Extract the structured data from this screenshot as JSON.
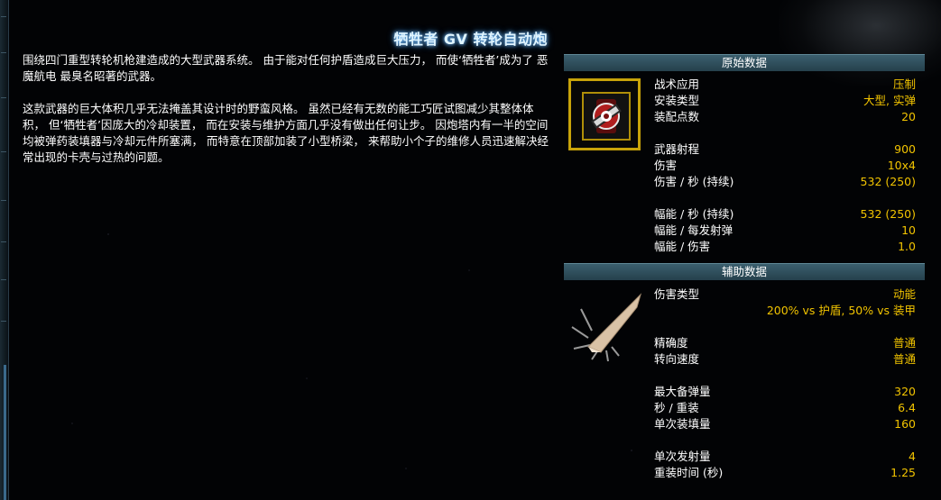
{
  "weapon": {
    "name": "牺牲者 GV 转轮自动炮",
    "description": [
      "围绕四门重型转轮机枪建造成的大型武器系统。 由于能对任何护盾造成巨大压力， 而使‘牺牲者’成为了 恶魔航电 最臭名昭著的武器。",
      "这款武器的巨大体积几乎无法掩盖其设计时的野蛮风格。 虽然已经有无数的能工巧匠试图减少其整体体积， 但‘牺牲者’因庞大的冷却装置， 而在安装与维护方面几乎没有做出任何让步。 因炮塔内有一半的空间均被弹药装填器与冷却元件所塞满， 而特意在顶部加装了小型桥梁， 来帮助小个子的维修人员迅速解决经常出现的卡壳与过热的问题。"
    ]
  },
  "primary": {
    "header": "原始数据",
    "icon": "turret-weapon-icon",
    "groups": [
      [
        {
          "label": "战术应用",
          "value": "压制"
        },
        {
          "label": "安装类型",
          "value": "大型, 实弹"
        },
        {
          "label": "装配点数",
          "value": "20"
        }
      ],
      [
        {
          "label": "武器射程",
          "value": "900"
        },
        {
          "label": "伤害",
          "value": "10x4"
        },
        {
          "label": "伤害 / 秒 (持续)",
          "value": "532 (250)"
        }
      ],
      [
        {
          "label": "幅能 / 秒 (持续)",
          "value": "532 (250)"
        },
        {
          "label": "幅能 / 每发射弹",
          "value": "10"
        },
        {
          "label": "幅能 / 伤害",
          "value": "1.0"
        }
      ]
    ]
  },
  "secondary": {
    "header": "辅助数据",
    "icon": "kinetic-damage-icon",
    "damage_type_label": "伤害类型",
    "damage_type_value": "动能",
    "damage_modifier": "200% vs 护盾, 50% vs 装甲",
    "groups": [
      [
        {
          "label": "精确度",
          "value": "普通"
        },
        {
          "label": "转向速度",
          "value": "普通"
        }
      ],
      [
        {
          "label": "最大备弹量",
          "value": "320"
        },
        {
          "label": "秒 / 重装",
          "value": "6.4"
        },
        {
          "label": "单次装填量",
          "value": "160"
        }
      ],
      [
        {
          "label": "单次发射量",
          "value": "4"
        },
        {
          "label": "重装时间 (秒)",
          "value": "1.25"
        }
      ]
    ]
  },
  "colors": {
    "accent_value": "#f2c400",
    "header_bg": "#2f4f5c",
    "title_glow": "#7fc4ff"
  }
}
